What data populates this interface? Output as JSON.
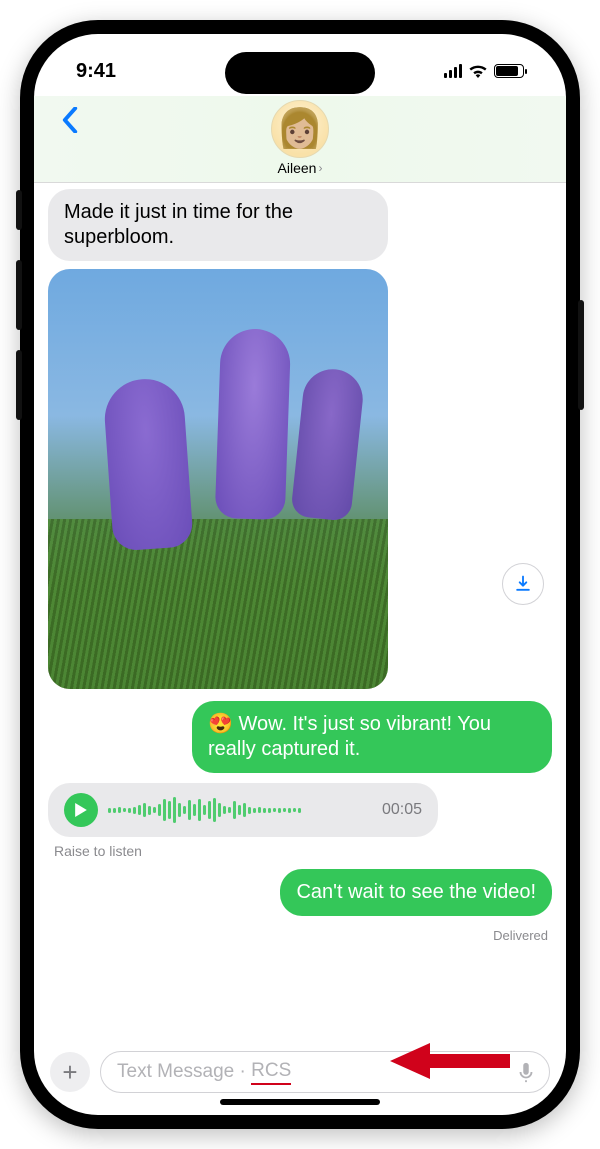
{
  "status": {
    "time": "9:41"
  },
  "header": {
    "contact_name": "Aileen"
  },
  "messages": {
    "incoming_text": "Made it just in time for the superbloom.",
    "outgoing_reply": "Wow. It's just so vibrant! You really captured it.",
    "outgoing_reply_emoji": "😍",
    "audio_duration": "00:05",
    "audio_hint": "Raise to listen",
    "outgoing_second": "Can't wait to see the video!",
    "delivery_status": "Delivered"
  },
  "input": {
    "placeholder_prefix": "Text Message",
    "separator": "·",
    "protocol": "RCS"
  },
  "colors": {
    "accent_green": "#34c759",
    "ios_blue": "#0a7aff",
    "gray_bubble": "#e9e9eb",
    "annotation_red": "#d0021b"
  }
}
